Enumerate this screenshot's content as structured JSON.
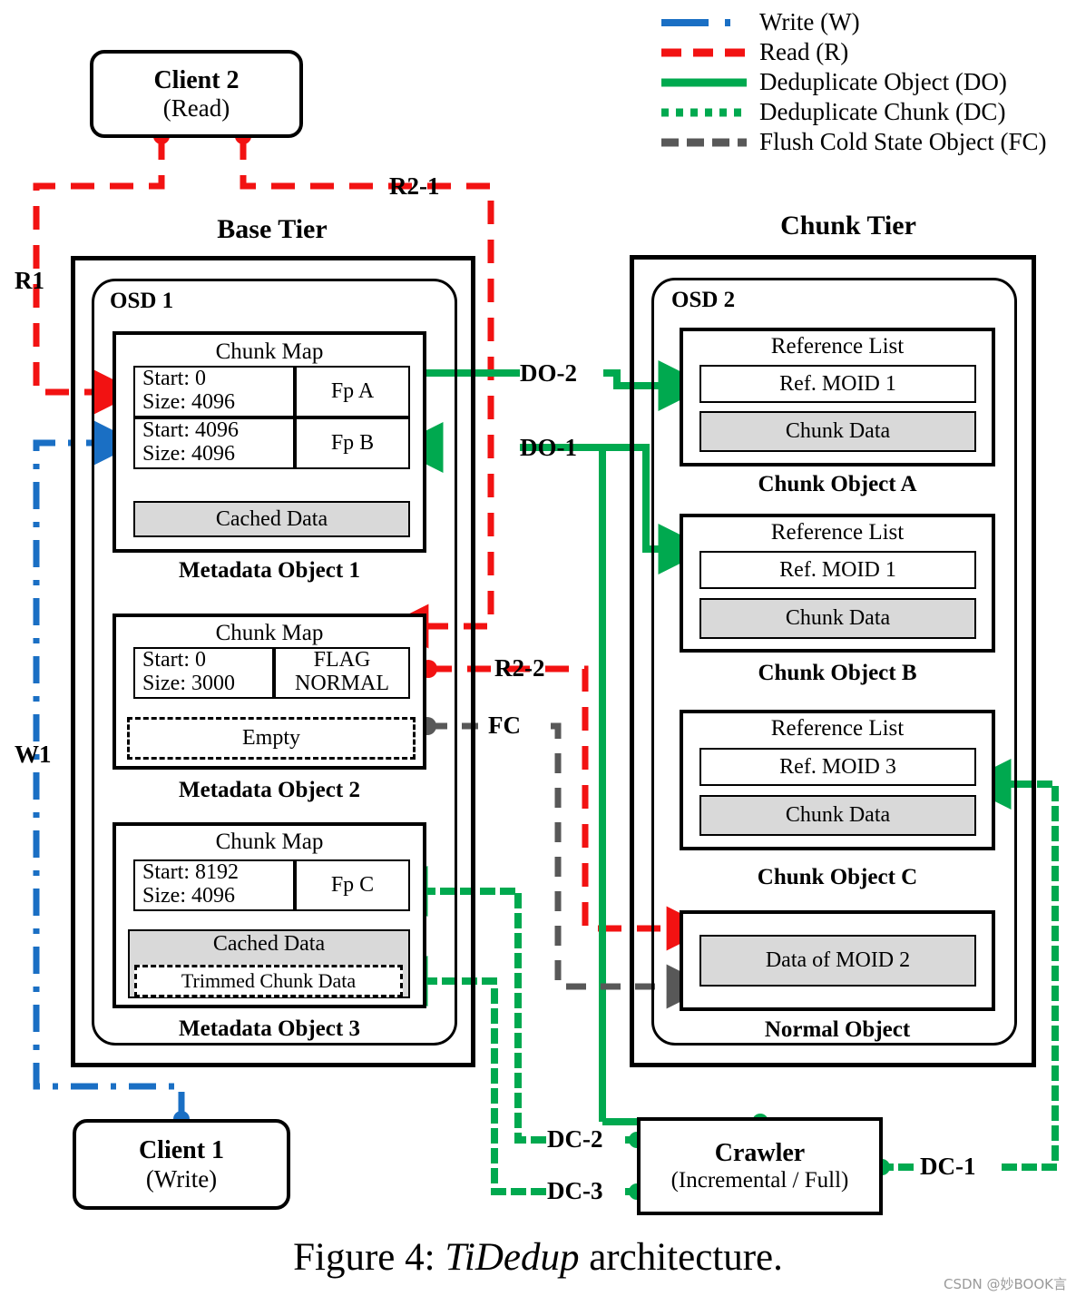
{
  "legend": {
    "items": [
      {
        "label": "Write (W)",
        "style": "dash-dot",
        "color": "#1a6fc4"
      },
      {
        "label": "Read (R)",
        "style": "dashed",
        "color": "#f21212"
      },
      {
        "label": "Deduplicate Object (DO)",
        "style": "solid",
        "color": "#00a94f"
      },
      {
        "label": "Deduplicate Chunk (DC)",
        "style": "dotted",
        "color": "#00a94f"
      },
      {
        "label": "Flush Cold State Object (FC)",
        "style": "dashed",
        "color": "#585858"
      }
    ]
  },
  "clients": {
    "client2": {
      "line1": "Client 2",
      "line2": "(Read)"
    },
    "client1": {
      "line1": "Client 1",
      "line2": "(Write)"
    }
  },
  "crawler": {
    "line1": "Crawler",
    "line2": "(Incremental / Full)"
  },
  "base_tier": {
    "title": "Base Tier",
    "osd_label": "OSD 1",
    "objects": [
      {
        "caption": "Metadata Object 1",
        "header": "Chunk Map",
        "rows": [
          {
            "left_line1": "Start: 0",
            "left_line2": "Size: 4096",
            "right_line1": "Fp A",
            "right_line2": ""
          },
          {
            "left_line1": "Start: 4096",
            "left_line2": "Size: 4096",
            "right_line1": "Fp B",
            "right_line2": ""
          }
        ],
        "data_label": "Cached Data",
        "data_style": "shaded"
      },
      {
        "caption": "Metadata Object 2",
        "header": "Chunk Map",
        "rows": [
          {
            "left_line1": "Start: 0",
            "left_line2": "Size: 3000",
            "right_line1": "FLAG",
            "right_line2": "NORMAL"
          }
        ],
        "data_label": "Empty",
        "data_style": "dashed"
      },
      {
        "caption": "Metadata Object 3",
        "header": "Chunk Map",
        "rows": [
          {
            "left_line1": "Start: 8192",
            "left_line2": "Size: 4096",
            "right_line1": "Fp C",
            "right_line2": ""
          }
        ],
        "data_label": "Cached Data",
        "data_style": "shaded",
        "trimmed_label": "Trimmed Chunk Data"
      }
    ]
  },
  "chunk_tier": {
    "title": "Chunk Tier",
    "osd_label": "OSD 2",
    "objects": [
      {
        "caption": "Chunk Object A",
        "header": "Reference List",
        "ref": "Ref. MOID 1",
        "data_label": "Chunk Data"
      },
      {
        "caption": "Chunk Object B",
        "header": "Reference List",
        "ref": "Ref. MOID 1",
        "data_label": "Chunk Data"
      },
      {
        "caption": "Chunk Object C",
        "header": "Reference List",
        "ref": "Ref. MOID 3",
        "data_label": "Chunk Data"
      },
      {
        "caption": "Normal Object",
        "header": "",
        "ref": "",
        "data_label": "Data of MOID 2"
      }
    ]
  },
  "flow_labels": {
    "r1": "R1",
    "r2_1": "R2-1",
    "r2_2": "R2-2",
    "w1": "W1",
    "do1": "DO-1",
    "do2": "DO-2",
    "dc1": "DC-1",
    "dc2": "DC-2",
    "dc3": "DC-3",
    "fc": "FC"
  },
  "caption": {
    "prefix": "Figure 4: ",
    "italic": "TiDedup",
    "suffix": " architecture."
  },
  "watermark": "CSDN @妙BOOK言",
  "colors": {
    "write": "#1a6fc4",
    "read": "#f21212",
    "dedup": "#00a94f",
    "flush": "#585858",
    "shade": "#d9d9d9"
  }
}
